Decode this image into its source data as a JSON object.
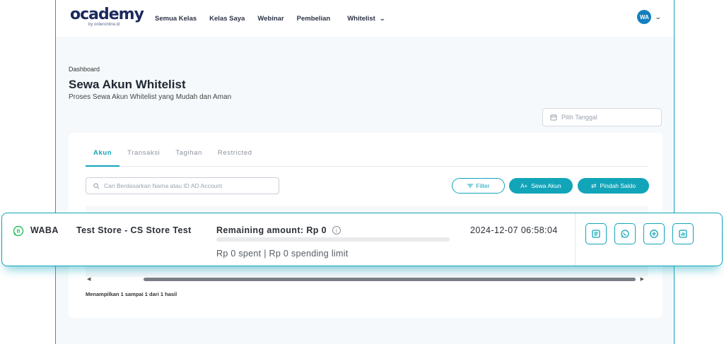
{
  "nav": {
    "logo": "ocademy",
    "logo_sub": "by orderonline.id",
    "links": [
      "Semua Kelas",
      "Kelas Saya",
      "Webinar",
      "Pembelian"
    ],
    "dropdown_label": "Whitelist",
    "avatar_initials": "WA"
  },
  "page": {
    "breadcrumb": "Dashboard",
    "title": "Sewa Akun Whitelist",
    "subtitle": "Proses Sewa Akun Whitelist yang Mudah dan Aman",
    "date_placeholder": "Pilih Tanggal"
  },
  "tabs": [
    "Akun",
    "Transaksi",
    "Tagihan",
    "Restricted"
  ],
  "toolbar": {
    "search_placeholder": "Cari Berdasarkan Nama atau ID AD Account",
    "filter_label": "Filter",
    "sewa_label": "Sewa Akun",
    "pindah_label": "Pindah Saldo"
  },
  "footer": {
    "showing": "Menampilkan 1 sampai 1 dari 1 hasil"
  },
  "row": {
    "type": "WABA",
    "store": "Test Store - CS Store Test",
    "remaining": "Remaining amount: Rp 0",
    "spent_fraction": 0,
    "spent_text": "Rp 0 spent  |  Rp 0 spending limit",
    "datetime": "2024-12-07 06:58:04",
    "actions": [
      "document-icon",
      "whatsapp-icon",
      "plus-circle-icon",
      "chart-icon"
    ]
  },
  "colors": {
    "accent": "#12a5ba",
    "avatar": "#147fbf",
    "logo": "#1c2a5e"
  }
}
